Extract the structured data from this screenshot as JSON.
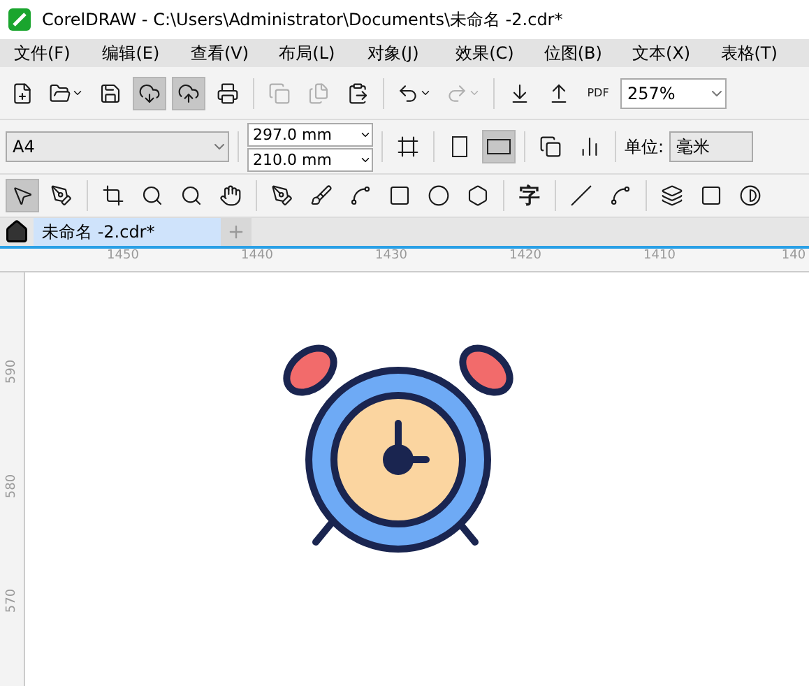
{
  "window": {
    "title": "CorelDRAW - C:\\Users\\Administrator\\Documents\\未命名 -2.cdr*"
  },
  "menu": [
    "文件(F)",
    "编辑(E)",
    "查看(V)",
    "布局(L)",
    "对象(J)",
    "效果(C)",
    "位图(B)",
    "文本(X)",
    "表格(T)"
  ],
  "toolbar": [
    {
      "kind": "new",
      "active": false,
      "disabled": false
    },
    {
      "kind": "open",
      "active": false,
      "disabled": false
    },
    {
      "kind": "save",
      "active": false,
      "disabled": false
    },
    {
      "kind": "cloud-down",
      "active": true,
      "disabled": false
    },
    {
      "kind": "cloud-up",
      "active": true,
      "disabled": false
    },
    {
      "kind": "print",
      "active": false,
      "disabled": false
    },
    {
      "kind": "sep"
    },
    {
      "kind": "cut",
      "active": false,
      "disabled": true
    },
    {
      "kind": "copy",
      "active": false,
      "disabled": true
    },
    {
      "kind": "paste",
      "active": false,
      "disabled": false
    },
    {
      "kind": "sep"
    },
    {
      "kind": "undo",
      "active": false,
      "disabled": false
    },
    {
      "kind": "redo",
      "active": false,
      "disabled": true
    },
    {
      "kind": "sep"
    },
    {
      "kind": "import",
      "active": false,
      "disabled": false
    },
    {
      "kind": "export",
      "active": false,
      "disabled": false
    },
    {
      "kind": "pdf",
      "label": "PDF",
      "active": false,
      "disabled": false
    }
  ],
  "zoom": {
    "value": "257%"
  },
  "property_bar": {
    "page_size": "A4",
    "width": "297.0 mm",
    "height": "210.0 mm",
    "portrait_selected": false,
    "landscape_selected": true,
    "units_label": "单位:",
    "units": "毫米"
  },
  "tools": [
    {
      "kind": "pick",
      "selected": true
    },
    {
      "kind": "shape",
      "selected": false
    },
    {
      "kind": "sep"
    },
    {
      "kind": "crop",
      "selected": false
    },
    {
      "kind": "zoom",
      "selected": false
    },
    {
      "kind": "zoom",
      "selected": false
    },
    {
      "kind": "pan",
      "selected": false
    },
    {
      "kind": "sep"
    },
    {
      "kind": "pen",
      "selected": false
    },
    {
      "kind": "brush",
      "selected": false
    },
    {
      "kind": "spiral",
      "selected": false
    },
    {
      "kind": "rect",
      "selected": false
    },
    {
      "kind": "ellipse",
      "selected": false
    },
    {
      "kind": "polygon",
      "selected": false
    },
    {
      "kind": "sep"
    },
    {
      "kind": "text",
      "label": "字",
      "selected": false
    },
    {
      "kind": "sep"
    },
    {
      "kind": "line",
      "selected": false
    },
    {
      "kind": "connector",
      "selected": false
    },
    {
      "kind": "sep"
    },
    {
      "kind": "blend",
      "selected": false
    },
    {
      "kind": "shadow",
      "selected": false
    },
    {
      "kind": "transparency",
      "selected": false
    }
  ],
  "tabs": [
    {
      "label": "未命名 -2.cdr*",
      "selected": true
    }
  ],
  "ruler": {
    "horizontal": [
      "1450",
      "1440",
      "1430",
      "1420",
      "1410",
      "140"
    ],
    "vertical": [
      "590",
      "580",
      "570"
    ]
  }
}
